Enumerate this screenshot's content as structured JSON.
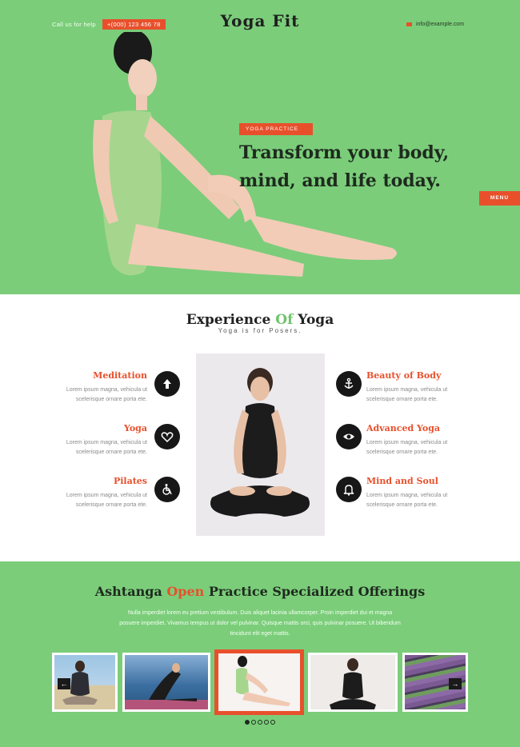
{
  "header": {
    "call_label": "Call us for help",
    "phone": "+(000) 123 456 78",
    "logo": "Yoga Fit",
    "email": "info@example.com",
    "menu": "MENU"
  },
  "hero": {
    "tag": "YOGA PRACTICE",
    "headline": "Transform your body, mind, and life today."
  },
  "experience": {
    "title_a": "Experience ",
    "title_accent": "Of",
    "title_b": " Yoga",
    "subtitle": "Yoga is for Posers.",
    "features_left": [
      {
        "title": "Meditation",
        "text": "Lorem ipsum magna, vehicula ut scelerisque ornare porta ete.",
        "icon": "arrow-up-icon"
      },
      {
        "title": "Yoga",
        "text": "Lorem ipsum magna, vehicula ut scelerisque ornare porta ete.",
        "icon": "heart-icon"
      },
      {
        "title": "Pilates",
        "text": "Lorem ipsum magna, vehicula ut scelerisque ornare porta ete.",
        "icon": "wheelchair-icon"
      }
    ],
    "features_right": [
      {
        "title": "Beauty of Body",
        "text": "Lorem ipsum magna, vehicula ut scelerisque ornare porta ete.",
        "icon": "anchor-icon"
      },
      {
        "title": "Advanced Yoga",
        "text": "Lorem ipsum magna, vehicula ut scelerisque ornare porta ete.",
        "icon": "eye-icon"
      },
      {
        "title": "Mind and Soul",
        "text": "Lorem ipsum magna, vehicula ut scelerisque ornare porta ete.",
        "icon": "bell-icon"
      }
    ]
  },
  "offerings": {
    "title_a": "Ashtanga ",
    "title_accent": "Open",
    "title_b": " Practice Specialized Offerings",
    "text": "Nulla imperdiet lorem eu pretium vestibulum. Duis aliquet lacinia ullamcorper. Proin imperdiet dui et magna posuere imperdiet. Vivamus tempus ut dolor vel pulvinar. Quisque mattis orci, quis pulvinar posuere. Ut bibendum tincidunt elit eget mattis.",
    "prev": "←",
    "next": "→"
  },
  "colors": {
    "green": "#7bcd7a",
    "accent": "#e8502c",
    "dark": "#171717"
  }
}
